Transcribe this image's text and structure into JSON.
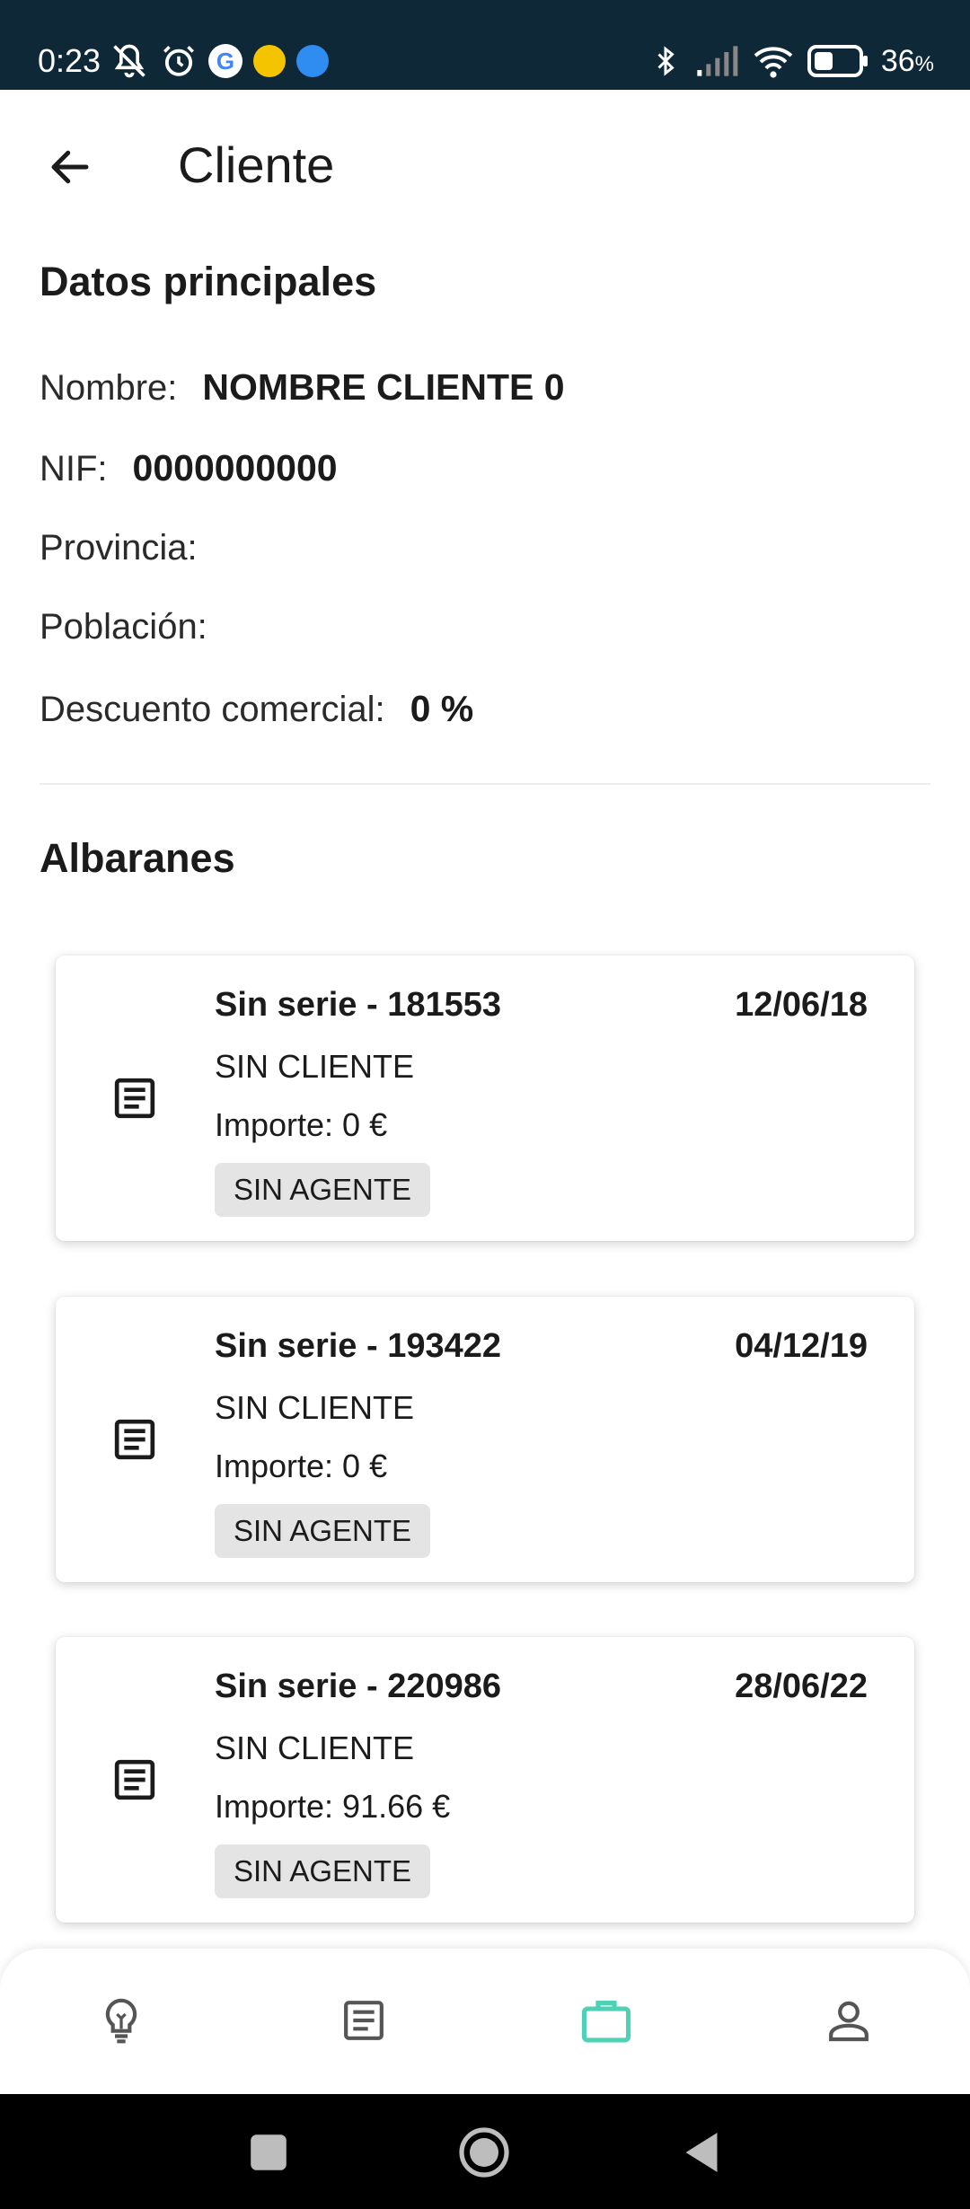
{
  "status_bar": {
    "time": "0:23",
    "battery": "36",
    "battery_unit": "%",
    "icons": [
      "mute-icon",
      "alarm-icon",
      "google-icon",
      "app-icon",
      "app-icon",
      "bluetooth-icon",
      "signal-icon",
      "wifi-icon",
      "battery-icon"
    ]
  },
  "app_bar": {
    "title": "Cliente",
    "back_icon": "arrow-left-icon"
  },
  "main_data": {
    "heading": "Datos principales",
    "fields": [
      {
        "label": "Nombre:",
        "value": "NOMBRE CLIENTE 0"
      },
      {
        "label": "NIF:",
        "value": "0000000000"
      },
      {
        "label": "Provincia:",
        "value": ""
      },
      {
        "label": "Población:",
        "value": ""
      },
      {
        "label": "Descuento comercial:",
        "value": "0 %"
      }
    ]
  },
  "albaranes": {
    "heading": "Albaranes",
    "items": [
      {
        "title": "Sin serie - 181553",
        "date": "12/06/18",
        "client": "SIN CLIENTE",
        "amount": "Importe: 0 €",
        "badge": "SIN AGENTE"
      },
      {
        "title": "Sin serie - 193422",
        "date": "04/12/19",
        "client": "SIN CLIENTE",
        "amount": "Importe: 0 €",
        "badge": "SIN AGENTE"
      },
      {
        "title": "Sin serie - 220986",
        "date": "28/06/22",
        "client": "SIN CLIENTE",
        "amount": "Importe: 91.66 €",
        "badge": "SIN AGENTE"
      }
    ]
  },
  "bottom_nav": {
    "items": [
      {
        "icon": "lightbulb-icon",
        "active": false
      },
      {
        "icon": "document-icon",
        "active": false
      },
      {
        "icon": "briefcase-icon",
        "active": true
      },
      {
        "icon": "person-icon",
        "active": false
      }
    ],
    "active_color": "#4fd1b5",
    "inactive_color": "#555555"
  },
  "colors": {
    "status_bar_bg": "#0e2838",
    "badge_bg": "#e4e4e4"
  }
}
